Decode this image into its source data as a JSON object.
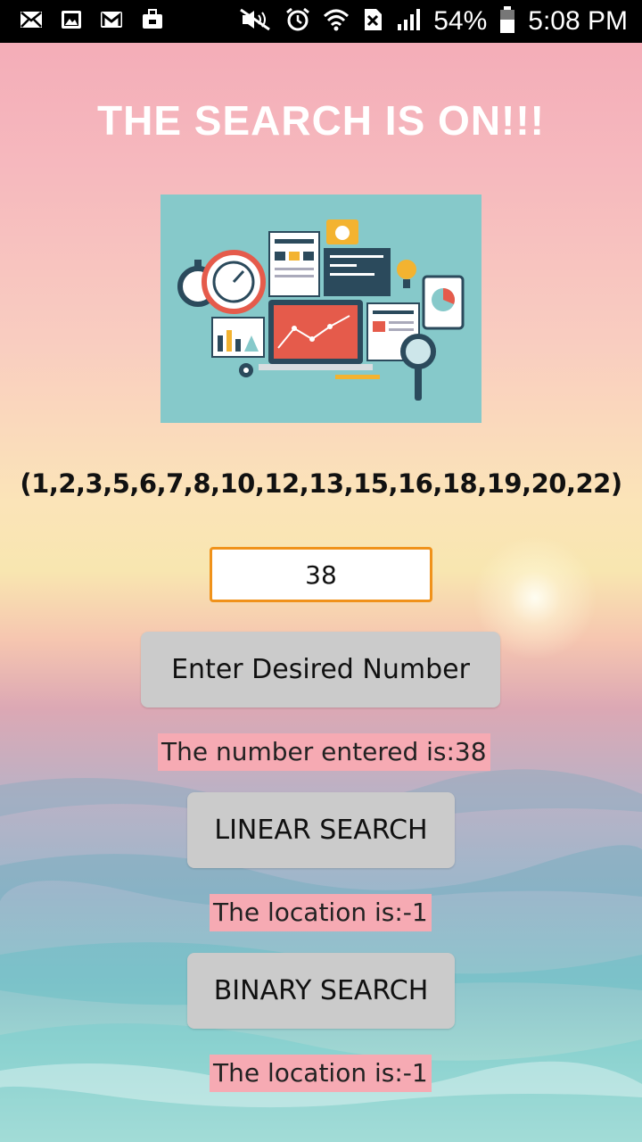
{
  "status_bar": {
    "icons": [
      "mail-icon",
      "image-icon",
      "gmail-icon",
      "briefcase-icon",
      "mute-icon",
      "alarm-icon",
      "wifi-icon",
      "no-sim-icon",
      "signal-icon",
      "battery-icon"
    ],
    "battery": "54%",
    "time": "5:08 PM"
  },
  "page": {
    "title": "THE SEARCH IS ON!!!",
    "sequence": "(1,2,3,5,6,7,8,10,12,13,15,16,18,19,20,22)",
    "number_input_value": "38",
    "enter_button": "Enter Desired Number",
    "entered_result": "The number entered is:38",
    "linear_button": "LINEAR SEARCH",
    "linear_result": "The location is:-1",
    "binary_button": "BINARY SEARCH",
    "binary_result": "The location is:-1"
  },
  "colors": {
    "input_border": "#f0921a",
    "button_bg": "#cbcbcb",
    "result_bg": "#f6aab3",
    "illustration_bg": "#86c9ca"
  }
}
